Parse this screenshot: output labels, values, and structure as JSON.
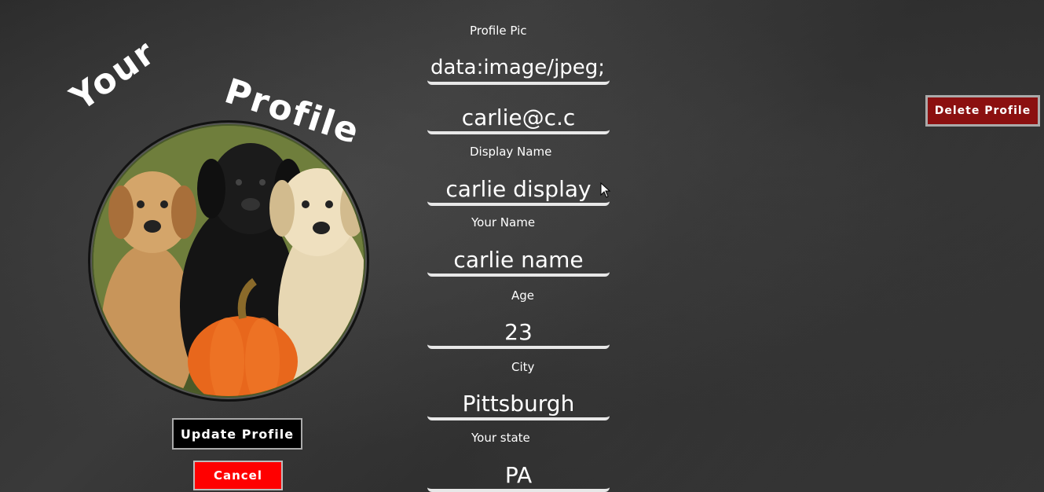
{
  "header": {
    "title_word_1": "Your",
    "title_word_2": "Profile"
  },
  "avatar": {
    "image_desc": "three puppies with pumpkin"
  },
  "buttons": {
    "update_label": "Update Profile",
    "cancel_label": "Cancel",
    "delete_label": "Delete Profile"
  },
  "form": {
    "profile_pic": {
      "label": "Profile Pic",
      "value": "data:image/jpeg;b"
    },
    "email": {
      "value": "carlie@c.c"
    },
    "display_name": {
      "label": "Display Name",
      "value": "carlie display"
    },
    "your_name": {
      "label": "Your Name",
      "value": "carlie name"
    },
    "age": {
      "label": "Age",
      "value": "23"
    },
    "city": {
      "label": "City",
      "value": "Pittsburgh"
    },
    "state": {
      "label": "Your state",
      "value": "PA"
    }
  },
  "colors": {
    "cancel": "#ff0000",
    "delete": "#8b1010",
    "update": "#000000"
  }
}
